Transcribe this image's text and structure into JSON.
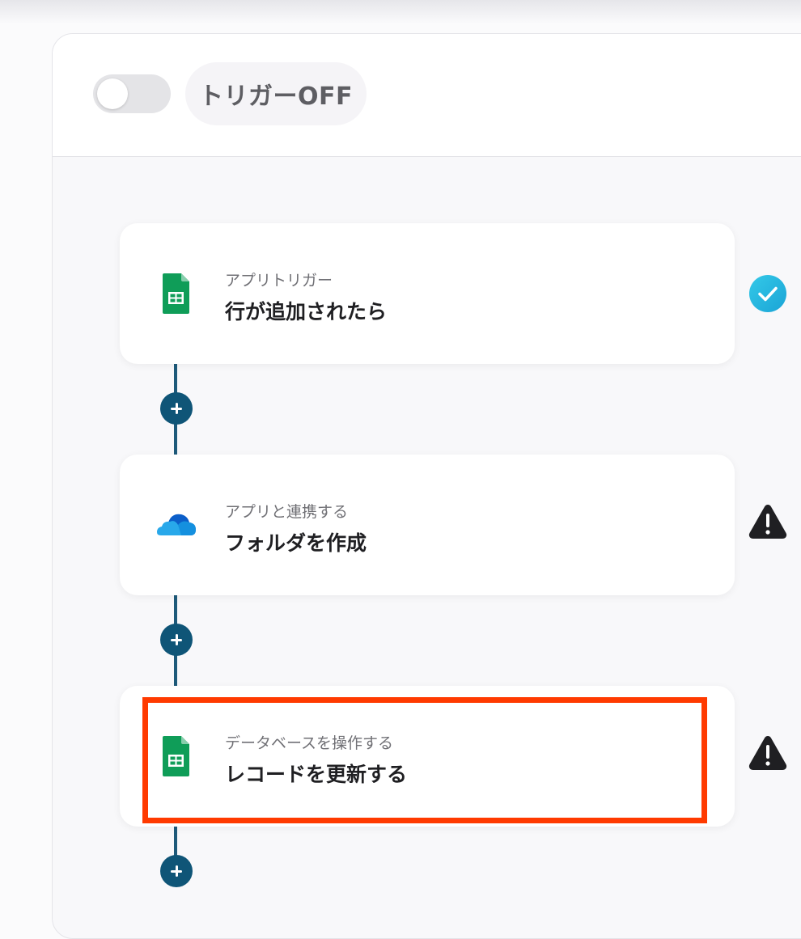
{
  "header": {
    "trigger_status_label": "トリガーOFF",
    "trigger_enabled": false
  },
  "flow": {
    "steps": [
      {
        "subtitle": "アプリトリガー",
        "title": "行が追加されたら",
        "app_icon": "google-sheets-icon",
        "status": "check-circle-icon",
        "status_color": "#20b4dd"
      },
      {
        "subtitle": "アプリと連携する",
        "title": "フォルダを作成",
        "app_icon": "onedrive-icon",
        "status": "warning-icon",
        "status_color": "#1f1f22"
      },
      {
        "subtitle": "データベースを操作する",
        "title": "レコードを更新する",
        "app_icon": "google-sheets-icon",
        "status": "warning-icon",
        "status_color": "#1f1f22",
        "highlighted": true
      }
    ],
    "line_color": "#1e5a7a",
    "add_button_color": "#0f5577",
    "highlight_color": "#ff3a00"
  }
}
